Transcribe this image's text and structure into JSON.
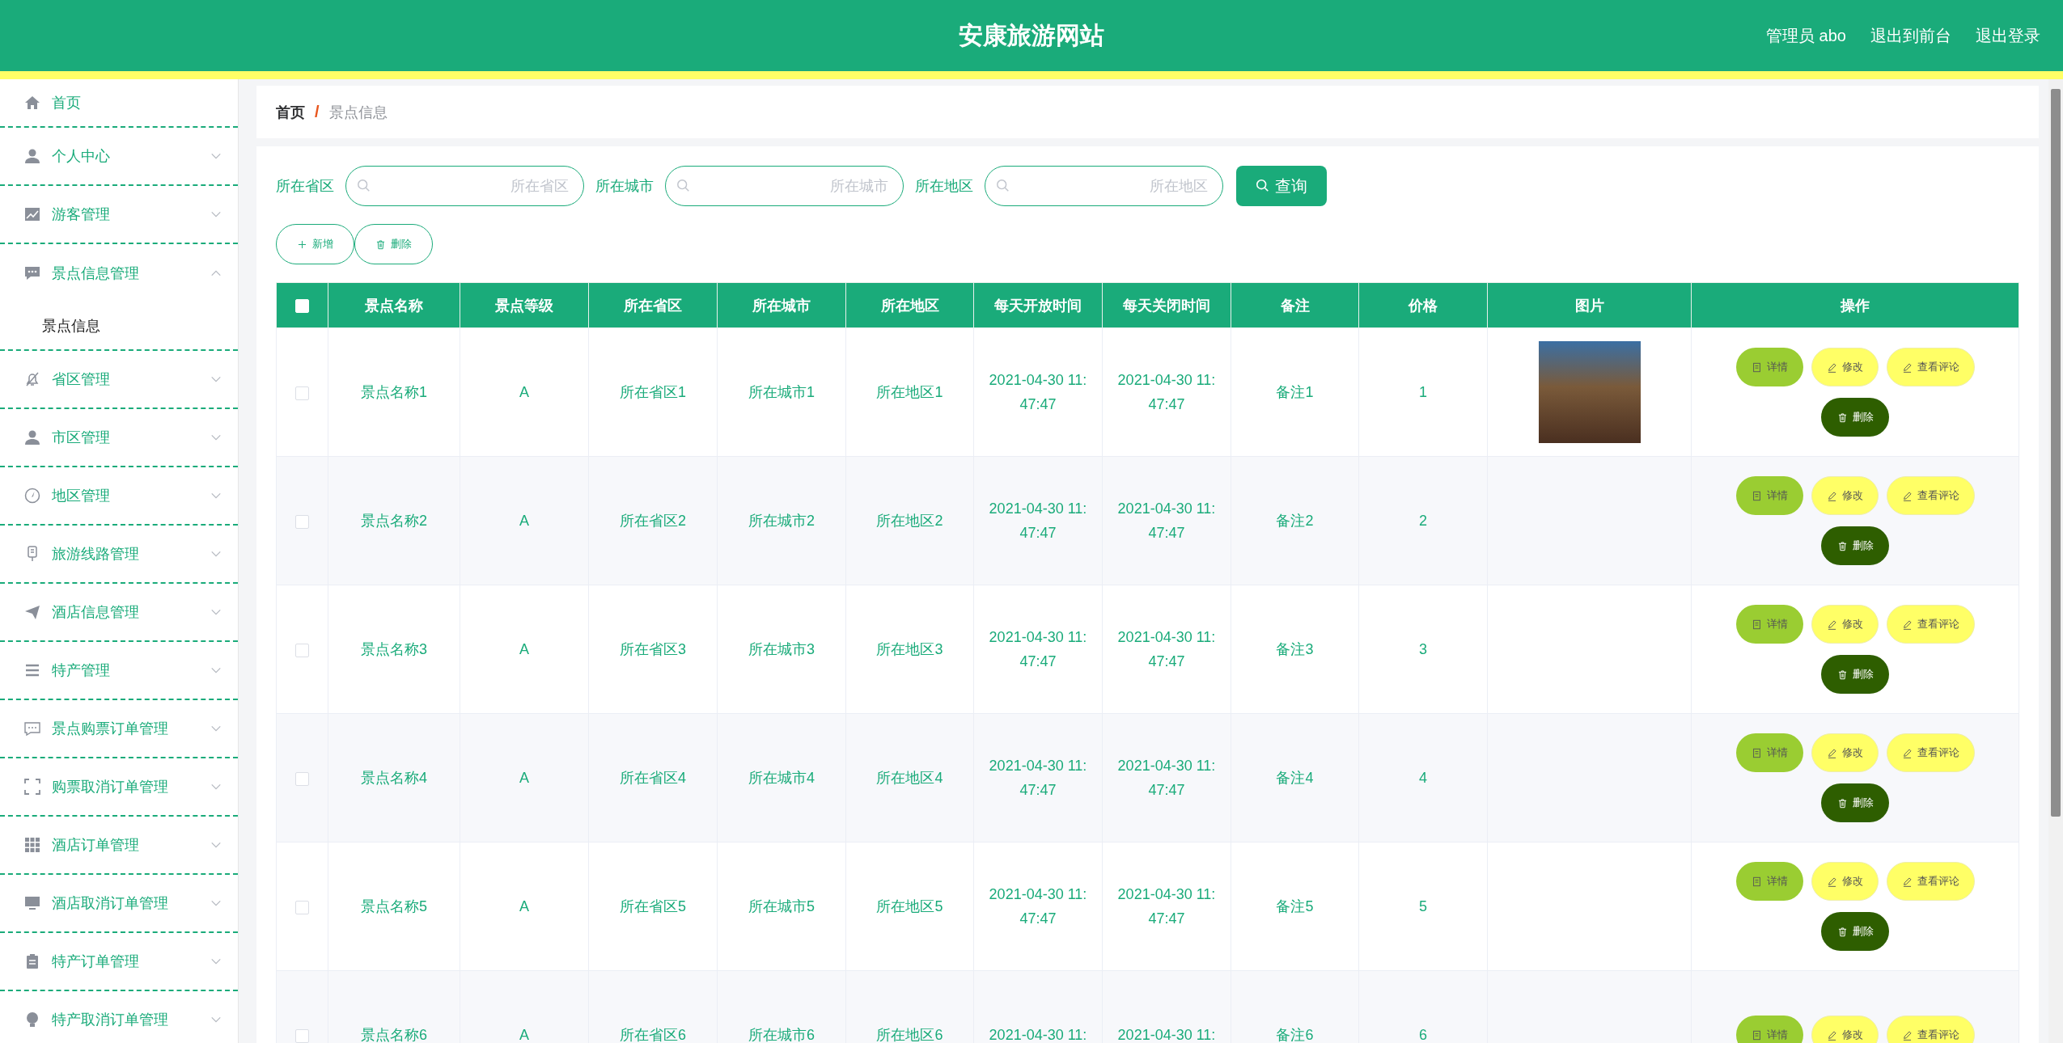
{
  "header": {
    "title": "安康旅游网站",
    "links": [
      "管理员 abo",
      "退出到前台",
      "退出登录"
    ]
  },
  "sidebar": {
    "items": [
      {
        "kind": "link",
        "label": "首页"
      },
      {
        "kind": "menu",
        "label": "个人中心",
        "expanded": false
      },
      {
        "kind": "menu",
        "label": "游客管理",
        "expanded": false
      },
      {
        "kind": "menu",
        "label": "景点信息管理",
        "expanded": true,
        "children": [
          {
            "label": "景点信息",
            "selected": true
          }
        ]
      },
      {
        "kind": "menu",
        "label": "省区管理",
        "expanded": false
      },
      {
        "kind": "menu",
        "label": "市区管理",
        "expanded": false
      },
      {
        "kind": "menu",
        "label": "地区管理",
        "expanded": false
      },
      {
        "kind": "menu",
        "label": "旅游线路管理",
        "expanded": false
      },
      {
        "kind": "menu",
        "label": "酒店信息管理",
        "expanded": false
      },
      {
        "kind": "menu",
        "label": "特产管理",
        "expanded": false
      },
      {
        "kind": "menu",
        "label": "景点购票订单管理",
        "expanded": false
      },
      {
        "kind": "menu",
        "label": "购票取消订单管理",
        "expanded": false
      },
      {
        "kind": "menu",
        "label": "酒店订单管理",
        "expanded": false
      },
      {
        "kind": "menu",
        "label": "酒店取消订单管理",
        "expanded": false
      },
      {
        "kind": "menu",
        "label": "特产订单管理",
        "expanded": false
      },
      {
        "kind": "menu",
        "label": "特产取消订单管理",
        "expanded": false
      }
    ]
  },
  "breadcrumb": {
    "home": "首页",
    "separator": "/",
    "current": "景点信息"
  },
  "search": {
    "fields": [
      {
        "label": "所在省区",
        "placeholder": "所在省区"
      },
      {
        "label": "所在城市",
        "placeholder": "所在城市"
      },
      {
        "label": "所在地区",
        "placeholder": "所在地区"
      }
    ],
    "button": "查询"
  },
  "toolbar": [
    {
      "kind": "add",
      "label": "新增"
    },
    {
      "kind": "delete",
      "label": "删除"
    }
  ],
  "table": {
    "select_all": {
      "checked": false
    },
    "columns": [
      "景点名称",
      "景点等级",
      "所在省区",
      "所在城市",
      "所在地区",
      "每天开放时间",
      "每天关闭时间",
      "备注",
      "价格",
      "图片",
      "操作"
    ],
    "rows": [
      {
        "checked": false,
        "name": "景点名称1",
        "level": "A",
        "province": "所在省区1",
        "city": "所在城市1",
        "district": "所在地区1",
        "open_time": "2021-04-30 11:47:47",
        "close_time": "2021-04-30 11:47:47",
        "note": "备注1",
        "price": "1",
        "photo": true,
        "actions": [
          {
            "kind": "detail",
            "label": "详情"
          },
          {
            "kind": "edit",
            "label": "修改"
          },
          {
            "kind": "comments",
            "label": "查看评论"
          },
          {
            "kind": "delete",
            "label": "删除"
          }
        ]
      },
      {
        "checked": false,
        "name": "景点名称2",
        "level": "A",
        "province": "所在省区2",
        "city": "所在城市2",
        "district": "所在地区2",
        "open_time": "2021-04-30 11:47:47",
        "close_time": "2021-04-30 11:47:47",
        "note": "备注2",
        "price": "2",
        "photo": false,
        "actions": [
          {
            "kind": "detail",
            "label": "详情"
          },
          {
            "kind": "edit",
            "label": "修改"
          },
          {
            "kind": "comments",
            "label": "查看评论"
          },
          {
            "kind": "delete",
            "label": "删除"
          }
        ]
      },
      {
        "checked": false,
        "name": "景点名称3",
        "level": "A",
        "province": "所在省区3",
        "city": "所在城市3",
        "district": "所在地区3",
        "open_time": "2021-04-30 11:47:47",
        "close_time": "2021-04-30 11:47:47",
        "note": "备注3",
        "price": "3",
        "photo": false,
        "actions": [
          {
            "kind": "detail",
            "label": "详情"
          },
          {
            "kind": "edit",
            "label": "修改"
          },
          {
            "kind": "comments",
            "label": "查看评论"
          },
          {
            "kind": "delete",
            "label": "删除"
          }
        ]
      },
      {
        "checked": false,
        "name": "景点名称4",
        "level": "A",
        "province": "所在省区4",
        "city": "所在城市4",
        "district": "所在地区4",
        "open_time": "2021-04-30 11:47:47",
        "close_time": "2021-04-30 11:47:47",
        "note": "备注4",
        "price": "4",
        "photo": false,
        "actions": [
          {
            "kind": "detail",
            "label": "详情"
          },
          {
            "kind": "edit",
            "label": "修改"
          },
          {
            "kind": "comments",
            "label": "查看评论"
          },
          {
            "kind": "delete",
            "label": "删除"
          }
        ]
      },
      {
        "checked": false,
        "name": "景点名称5",
        "level": "A",
        "province": "所在省区5",
        "city": "所在城市5",
        "district": "所在地区5",
        "open_time": "2021-04-30 11:47:47",
        "close_time": "2021-04-30 11:47:47",
        "note": "备注5",
        "price": "5",
        "photo": false,
        "actions": [
          {
            "kind": "detail",
            "label": "详情"
          },
          {
            "kind": "edit",
            "label": "修改"
          },
          {
            "kind": "comments",
            "label": "查看评论"
          },
          {
            "kind": "delete",
            "label": "删除"
          }
        ]
      },
      {
        "checked": false,
        "name": "景点名称6",
        "level": "A",
        "province": "所在省区6",
        "city": "所在城市6",
        "district": "所在地区6",
        "open_time": "2021-04-30 11:",
        "close_time": "2021-04-30 11:",
        "note": "备注6",
        "price": "6",
        "photo": false,
        "actions": [
          {
            "kind": "detail",
            "label": "详情"
          },
          {
            "kind": "edit",
            "label": "修改"
          },
          {
            "kind": "comments",
            "label": "查看评论"
          }
        ]
      }
    ]
  }
}
